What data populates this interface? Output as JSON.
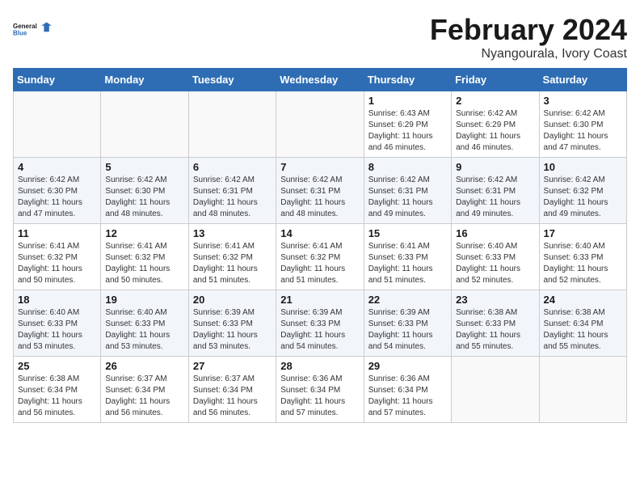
{
  "logo": {
    "line1": "General",
    "line2": "Blue"
  },
  "title": "February 2024",
  "subtitle": "Nyangourala, Ivory Coast",
  "headers": [
    "Sunday",
    "Monday",
    "Tuesday",
    "Wednesday",
    "Thursday",
    "Friday",
    "Saturday"
  ],
  "weeks": [
    [
      {
        "day": "",
        "info": ""
      },
      {
        "day": "",
        "info": ""
      },
      {
        "day": "",
        "info": ""
      },
      {
        "day": "",
        "info": ""
      },
      {
        "day": "1",
        "info": "Sunrise: 6:43 AM\nSunset: 6:29 PM\nDaylight: 11 hours and 46 minutes."
      },
      {
        "day": "2",
        "info": "Sunrise: 6:42 AM\nSunset: 6:29 PM\nDaylight: 11 hours and 46 minutes."
      },
      {
        "day": "3",
        "info": "Sunrise: 6:42 AM\nSunset: 6:30 PM\nDaylight: 11 hours and 47 minutes."
      }
    ],
    [
      {
        "day": "4",
        "info": "Sunrise: 6:42 AM\nSunset: 6:30 PM\nDaylight: 11 hours and 47 minutes."
      },
      {
        "day": "5",
        "info": "Sunrise: 6:42 AM\nSunset: 6:30 PM\nDaylight: 11 hours and 48 minutes."
      },
      {
        "day": "6",
        "info": "Sunrise: 6:42 AM\nSunset: 6:31 PM\nDaylight: 11 hours and 48 minutes."
      },
      {
        "day": "7",
        "info": "Sunrise: 6:42 AM\nSunset: 6:31 PM\nDaylight: 11 hours and 48 minutes."
      },
      {
        "day": "8",
        "info": "Sunrise: 6:42 AM\nSunset: 6:31 PM\nDaylight: 11 hours and 49 minutes."
      },
      {
        "day": "9",
        "info": "Sunrise: 6:42 AM\nSunset: 6:31 PM\nDaylight: 11 hours and 49 minutes."
      },
      {
        "day": "10",
        "info": "Sunrise: 6:42 AM\nSunset: 6:32 PM\nDaylight: 11 hours and 49 minutes."
      }
    ],
    [
      {
        "day": "11",
        "info": "Sunrise: 6:41 AM\nSunset: 6:32 PM\nDaylight: 11 hours and 50 minutes."
      },
      {
        "day": "12",
        "info": "Sunrise: 6:41 AM\nSunset: 6:32 PM\nDaylight: 11 hours and 50 minutes."
      },
      {
        "day": "13",
        "info": "Sunrise: 6:41 AM\nSunset: 6:32 PM\nDaylight: 11 hours and 51 minutes."
      },
      {
        "day": "14",
        "info": "Sunrise: 6:41 AM\nSunset: 6:32 PM\nDaylight: 11 hours and 51 minutes."
      },
      {
        "day": "15",
        "info": "Sunrise: 6:41 AM\nSunset: 6:33 PM\nDaylight: 11 hours and 51 minutes."
      },
      {
        "day": "16",
        "info": "Sunrise: 6:40 AM\nSunset: 6:33 PM\nDaylight: 11 hours and 52 minutes."
      },
      {
        "day": "17",
        "info": "Sunrise: 6:40 AM\nSunset: 6:33 PM\nDaylight: 11 hours and 52 minutes."
      }
    ],
    [
      {
        "day": "18",
        "info": "Sunrise: 6:40 AM\nSunset: 6:33 PM\nDaylight: 11 hours and 53 minutes."
      },
      {
        "day": "19",
        "info": "Sunrise: 6:40 AM\nSunset: 6:33 PM\nDaylight: 11 hours and 53 minutes."
      },
      {
        "day": "20",
        "info": "Sunrise: 6:39 AM\nSunset: 6:33 PM\nDaylight: 11 hours and 53 minutes."
      },
      {
        "day": "21",
        "info": "Sunrise: 6:39 AM\nSunset: 6:33 PM\nDaylight: 11 hours and 54 minutes."
      },
      {
        "day": "22",
        "info": "Sunrise: 6:39 AM\nSunset: 6:33 PM\nDaylight: 11 hours and 54 minutes."
      },
      {
        "day": "23",
        "info": "Sunrise: 6:38 AM\nSunset: 6:33 PM\nDaylight: 11 hours and 55 minutes."
      },
      {
        "day": "24",
        "info": "Sunrise: 6:38 AM\nSunset: 6:34 PM\nDaylight: 11 hours and 55 minutes."
      }
    ],
    [
      {
        "day": "25",
        "info": "Sunrise: 6:38 AM\nSunset: 6:34 PM\nDaylight: 11 hours and 56 minutes."
      },
      {
        "day": "26",
        "info": "Sunrise: 6:37 AM\nSunset: 6:34 PM\nDaylight: 11 hours and 56 minutes."
      },
      {
        "day": "27",
        "info": "Sunrise: 6:37 AM\nSunset: 6:34 PM\nDaylight: 11 hours and 56 minutes."
      },
      {
        "day": "28",
        "info": "Sunrise: 6:36 AM\nSunset: 6:34 PM\nDaylight: 11 hours and 57 minutes."
      },
      {
        "day": "29",
        "info": "Sunrise: 6:36 AM\nSunset: 6:34 PM\nDaylight: 11 hours and 57 minutes."
      },
      {
        "day": "",
        "info": ""
      },
      {
        "day": "",
        "info": ""
      }
    ]
  ]
}
